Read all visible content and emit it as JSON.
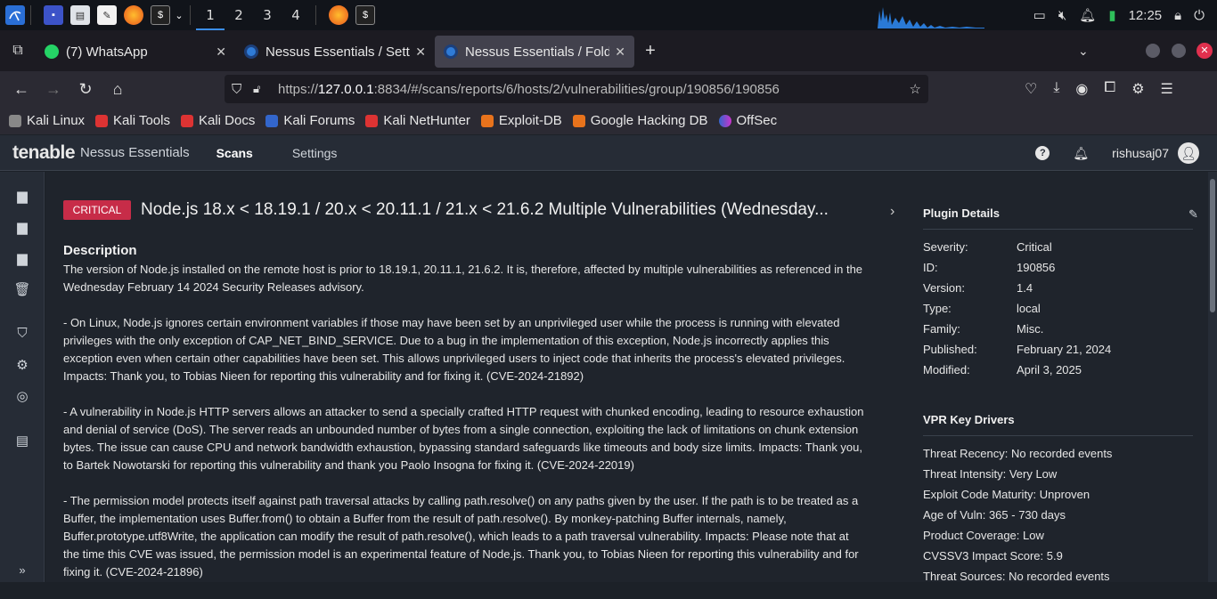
{
  "taskbar": {
    "workspaces": [
      "1",
      "2",
      "3",
      "4"
    ],
    "clock": "12:25"
  },
  "browser": {
    "tabs": [
      {
        "title": "(7) WhatsApp"
      },
      {
        "title": "Nessus Essentials / Settin"
      },
      {
        "title": "Nessus Essentials / Folde"
      }
    ],
    "url_prefix": "https://",
    "url_host": "127.0.0.1",
    "url_rest": ":8834/#/scans/reports/6/hosts/2/vulnerabilities/group/190856/190856",
    "bookmarks": [
      "Kali Linux",
      "Kali Tools",
      "Kali Docs",
      "Kali Forums",
      "Kali NetHunter",
      "Exploit-DB",
      "Google Hacking DB",
      "OffSec"
    ]
  },
  "app": {
    "brand": "tenable",
    "product": "Nessus Essentials",
    "nav": [
      "Scans",
      "Settings"
    ],
    "user": "rishusaj07"
  },
  "vuln": {
    "severity_badge": "CRITICAL",
    "title": "Node.js 18.x < 18.19.1 / 20.x < 20.11.1 / 21.x < 21.6.2 Multiple Vulnerabilities (Wednesday...",
    "description_heading": "Description",
    "paragraphs": [
      "The version of Node.js installed on the remote host is prior to 18.19.1, 20.11.1, 21.6.2. It is, therefore, affected by multiple vulnerabilities as referenced in the Wednesday February 14 2024 Security Releases advisory.",
      "- On Linux, Node.js ignores certain environment variables if those may have been set by an unprivileged user while the process is running with elevated privileges with the only exception of CAP_NET_BIND_SERVICE. Due to a bug in the implementation of this exception, Node.js incorrectly applies this exception even when certain other capabilities have been set. This allows unprivileged users to inject code that inherits the process's elevated privileges. Impacts: Thank you, to Tobias Nieen for reporting this vulnerability and for fixing it. (CVE-2024-21892)",
      "- A vulnerability in Node.js HTTP servers allows an attacker to send a specially crafted HTTP request with chunked encoding, leading to resource exhaustion and denial of service (DoS). The server reads an unbounded number of bytes from a single connection, exploiting the lack of limitations on chunk extension bytes. The issue can cause CPU and network bandwidth exhaustion, bypassing standard safeguards like timeouts and body size limits. Impacts: Thank you, to Bartek Nowotarski for reporting this vulnerability and thank you Paolo Insogna for fixing it. (CVE-2024-22019)",
      "- The permission model protects itself against path traversal attacks by calling path.resolve() on any paths given by the user. If the path is to be treated as a Buffer, the implementation uses Buffer.from() to obtain a Buffer from the result of path.resolve(). By monkey-patching Buffer internals, namely, Buffer.prototype.utf8Write, the application can modify the result of path.resolve(), which leads to a path traversal vulnerability. Impacts: Please note that at the time this CVE was issued, the permission model is an experimental feature of Node.js. Thank you, to Tobias Nieen for reporting this vulnerability and for fixing it. (CVE-2024-21896)"
    ]
  },
  "plugin_details": {
    "heading": "Plugin Details",
    "rows": [
      {
        "k": "Severity:",
        "v": "Critical"
      },
      {
        "k": "ID:",
        "v": "190856"
      },
      {
        "k": "Version:",
        "v": "1.4"
      },
      {
        "k": "Type:",
        "v": "local"
      },
      {
        "k": "Family:",
        "v": "Misc."
      },
      {
        "k": "Published:",
        "v": "February 21, 2024"
      },
      {
        "k": "Modified:",
        "v": "April 3, 2025"
      }
    ]
  },
  "vpr": {
    "heading": "VPR Key Drivers",
    "items": [
      "Threat Recency: No recorded events",
      "Threat Intensity: Very Low",
      "Exploit Code Maturity: Unproven",
      "Age of Vuln: 365 - 730 days",
      "Product Coverage: Low",
      "CVSSV3 Impact Score: 5.9",
      "Threat Sources: No recorded events"
    ]
  },
  "colors": {
    "critical": "#c72c48",
    "accent": "#3b8eea"
  }
}
